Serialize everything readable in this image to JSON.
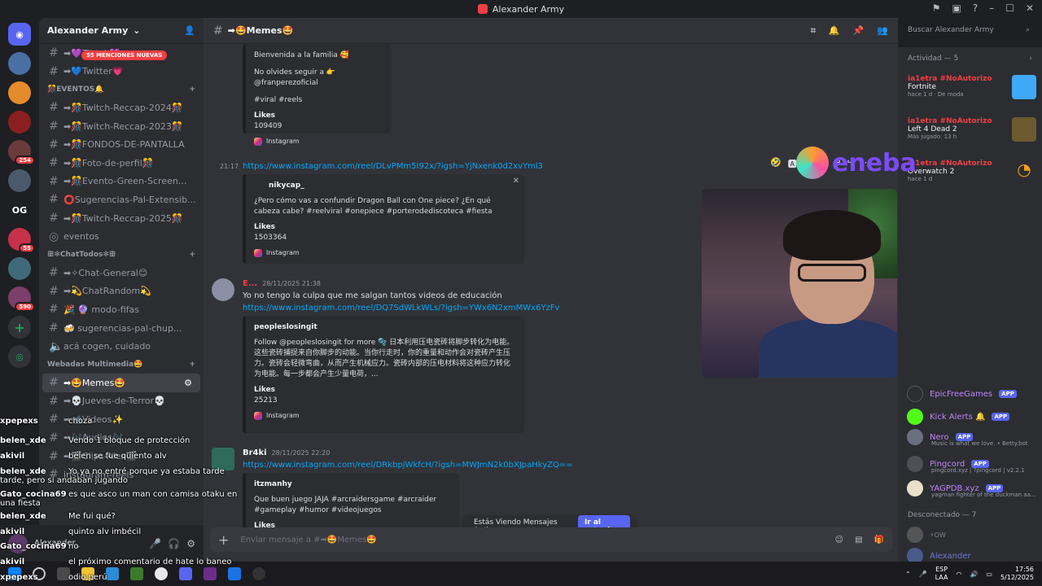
{
  "window": {
    "title": "Alexander Army"
  },
  "server": {
    "name": "Alexander Army",
    "mentions_pill": "55 MENCIONES NUEVAS"
  },
  "guild_badges": [
    "254",
    "55",
    "590"
  ],
  "guild_label_og": "OG",
  "channels_top": [
    "➡💜Tiktok💜",
    "➡💙Twitter💗"
  ],
  "categories": {
    "eventos": "🎊EVENTOS🔔",
    "chat_todos": "ꕥ✻ChatTodos✻ꕥ",
    "webadas": "Webadas Multimedia🤩"
  },
  "channels_eventos": [
    "➡🎊Twitch-Reccap-2024🎊",
    "➡🎊Twitch-Reccap-2023🎊",
    "➡🎊FONDOS-DE-PANTALLA",
    "➡🎊Foto-de-perfil🎊",
    "➡🎊Evento-Green-Screen...",
    "⭕Sugerencias-Pal-Extensib...",
    "➡🎊Twitch-Reccap-2025🎊",
    "eventos"
  ],
  "channels_chat": [
    "➡✧Chat-General😊",
    "➡💫ChatRandom💫",
    "🎉 🔮 modo-fifas",
    "🍻 sugerencias-pal-chup...",
    "acá cogen, cuidado"
  ],
  "channels_webadas": [
    "➡🤩Memes🤩",
    "➡💀Jueves-de-Terror💀",
    "➡📹Videos✨",
    "➡🎶Audios🎶",
    "➡🎬Clips-Alex🎬",
    "instagram-reels"
  ],
  "user": {
    "name": "Alexander_"
  },
  "stream_chat": [
    {
      "u": "xpepexs",
      "m": "choza"
    },
    {
      "u": "belen_xde",
      "m": "Vendo 1 bloque de protección"
    },
    {
      "u": "akivil",
      "m": "belen se fue quiento alv"
    },
    {
      "u": "belen_xde",
      "m": "Yo ya no entré porque ya estaba tarde tarde, pero si andaban jugando"
    },
    {
      "u": "Gato_cocina69",
      "m": "es que asco un man con camisa otaku en una fiesta"
    },
    {
      "u": "belen_xde",
      "m": "Me fui qué?"
    },
    {
      "u": "akivil",
      "m": "quinto alv imbécil"
    },
    {
      "u": "Gato_cocina69",
      "m": "no"
    },
    {
      "u": "akivil",
      "m": "el próximo comentario de hate lo baneo"
    },
    {
      "u": "xpepexs",
      "m": "odio perú"
    }
  ],
  "channel": {
    "name": "➡🤩Memes🤩",
    "search_placeholder": "Buscar Alexander Army",
    "composer_placeholder": "Enviar mensaje a #➡🤩Memes🤩"
  },
  "messages": {
    "embed1": {
      "lines": [
        "Bienvenida a la familia 🥰",
        "No olvides seguir a 👉@franperezoficial",
        "#viral #reels"
      ],
      "likes_label": "Likes",
      "likes": "109409",
      "source": "Instagram"
    },
    "msg2": {
      "time": "21:17",
      "link": "https://www.instagram.com/reel/DLvPMm5I92x/?igsh=YjNxenk0d2xvYml3",
      "author": "nikycap_",
      "text": "¿Pero cómo vas a confundir Dragon Ball con One piece? ¿En qué cabeza cabe? #reelviral #onepiece #porterodediscoteca #fiesta",
      "likes_label": "Likes",
      "likes": "1503364",
      "source": "Instagram"
    },
    "msg3": {
      "user": "E...",
      "date": "28/11/2025 21:38",
      "text": "Yo no tengo la culpa que me salgan tantos videos de educación",
      "link": "https://www.instagram.com/reel/DQ7SdWLkWLs/?igsh=YWx6N2xmMWx6YzFv",
      "author": "peopleslosingit",
      "body": "Follow @peopleslosingit for more 🫧 日本利用压电瓷砖将脚步转化为电能。这些瓷砖捕捉来自你脚步的动能。当你行走时，你的重量和动作会对瓷砖产生压力。瓷砖会轻微弯曲，从而产生机械应力。瓷砖内部的压电材料将这种应力转化为电能。每一步都会产生少量电荷，...",
      "likes_label": "Likes",
      "likes": "25213",
      "source": "Instagram"
    },
    "msg4": {
      "user": "Br4ki",
      "date": "28/11/2025 22:20",
      "link": "https://www.instagram.com/reel/DRkbpjWkfcH/?igsh=MWJmN2k0bXJpaHkyZQ==",
      "author": "itzmanhy",
      "text": "Que buen juego JAJA #arcraidersgame #arcraider #gameplay #humor #videojuegos",
      "likes_label": "Likes",
      "likes": "41580"
    }
  },
  "old_messages": {
    "label": "Estás Viendo Mensajes Antiguos",
    "button": "Ir al actual"
  },
  "activity": {
    "header": "Actividad — 5",
    "items": [
      {
        "user": "ia1etra #NoAutorizo",
        "game": "Fortnite",
        "meta": "hace 1 d · De moda"
      },
      {
        "user": "ia1etra #NoAutorizo",
        "game": "Left 4 Dead 2",
        "meta": "Más jugado: 13 h"
      },
      {
        "user": "ia1etra #NoAutorizo",
        "game": "Overwatch 2",
        "meta": "hace 1 d"
      }
    ]
  },
  "overlay_brand": "eneba",
  "members": [
    {
      "name": "EpicFreeGames",
      "tag": "APP",
      "sub": ""
    },
    {
      "name": "Kick Alerts 🔔",
      "tag": "APP",
      "sub": ""
    },
    {
      "name": "Nero",
      "tag": "APP",
      "sub": "Music is what we love. • Betty.bot"
    },
    {
      "name": "Pingcord",
      "tag": "APP",
      "sub": "pingcord.xyz | ?pingcord | v2.2.1"
    },
    {
      "name": "YAGPDB.xyz",
      "tag": "APP",
      "sub": "yagman fighter of the duckman aa..."
    }
  ],
  "offline_header": "Desconectado — 7",
  "offline_members": [
    "⚡OW",
    "Alexander"
  ],
  "taskbar": {
    "lang": "ESP",
    "lang2": "LAA",
    "time": "17:56",
    "date": "5/12/2025"
  }
}
